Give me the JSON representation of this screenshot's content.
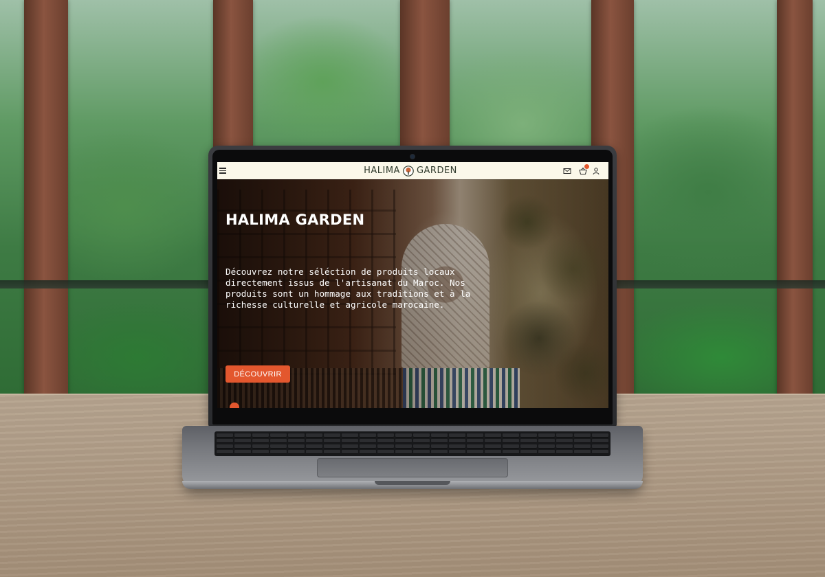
{
  "site": {
    "brand_left": "HALIMA",
    "brand_right": "GARDEN",
    "cart_count": "",
    "accent_color": "#e3572e",
    "header_bg": "#fbf8ea"
  },
  "header": {
    "icons": [
      "menu-icon",
      "mail-icon",
      "basket-icon",
      "user-icon"
    ]
  },
  "hero": {
    "title": "HALIMA GARDEN",
    "description": "Découvrez notre séléction de produits locaux directement issus de l'artisanat du Maroc. Nos produits sont un hommage aux traditions et à la richesse culturelle et agricole marocaine.",
    "cta_label": "DÉCOUVRIR"
  }
}
